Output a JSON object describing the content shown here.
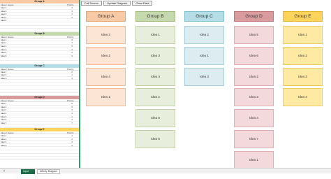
{
  "colors": {
    "a": {
      "header": "#f8c9a5",
      "headerBorder": "#e3a574",
      "card": "#fde5d6",
      "cardBorder": "#f2b994"
    },
    "b": {
      "header": "#c6d8ae",
      "headerBorder": "#9fbb7c",
      "card": "#e7eedc",
      "cardBorder": "#c2d3aa"
    },
    "c": {
      "header": "#b4dde5",
      "headerBorder": "#80c1ce",
      "card": "#dcecf1",
      "cardBorder": "#a9d1db"
    },
    "d": {
      "header": "#d99b9e",
      "headerBorder": "#c07478",
      "card": "#f3d9dc",
      "cardBorder": "#e0aeb2"
    },
    "e": {
      "header": "#ffd45c",
      "headerBorder": "#e3b423",
      "card": "#ffe9a3",
      "cardBorder": "#f1cd5f"
    }
  },
  "toolbar": {
    "full_screen": "Full Screen",
    "update_diagram": "Update Diagram",
    "clear_data": "Clear Data"
  },
  "sheet": {
    "col_idea": "Ideas / Issues",
    "col_priority": "Priority",
    "groups": [
      {
        "title": "Group A",
        "rows": [
          [
            "Idea 1",
            "4"
          ],
          [
            "Idea 2",
            "3"
          ],
          [
            "Idea 3",
            "1"
          ],
          [
            "Idea 4",
            "2"
          ],
          [
            "Idea 5",
            ""
          ],
          [
            "",
            ""
          ],
          [
            "",
            ""
          ],
          [
            "",
            ""
          ]
        ]
      },
      {
        "title": "Group B",
        "rows": [
          [
            "Idea 1",
            "6"
          ],
          [
            "Idea 2",
            "1"
          ],
          [
            "Idea 3",
            "5"
          ],
          [
            "Idea 4",
            "4"
          ],
          [
            "Idea 5",
            "2"
          ],
          [
            "Idea 6",
            "3"
          ],
          [
            "",
            ""
          ],
          [
            "",
            ""
          ]
        ]
      },
      {
        "title": "Group C",
        "rows": [
          [
            "Idea 1",
            "2"
          ],
          [
            "Idea 2",
            "1"
          ],
          [
            "Idea 3",
            "3"
          ],
          [
            "",
            ""
          ],
          [
            "",
            ""
          ],
          [
            "",
            ""
          ],
          [
            "",
            ""
          ],
          [
            "",
            ""
          ]
        ]
      },
      {
        "title": "Group D",
        "rows": [
          [
            "Idea 1",
            "6"
          ],
          [
            "Idea 2",
            "5"
          ],
          [
            "Idea 3",
            "3"
          ],
          [
            "Idea 4",
            "4"
          ],
          [
            "Idea 5",
            "1"
          ],
          [
            "Idea 6",
            "2"
          ],
          [
            "Idea 7",
            "7"
          ],
          [
            "",
            ""
          ]
        ]
      },
      {
        "title": "Group E",
        "rows": [
          [
            "Idea 1",
            "1"
          ],
          [
            "Idea 2",
            "2"
          ],
          [
            "Idea 3",
            "3"
          ],
          [
            "Idea 4",
            "4"
          ],
          [
            "",
            ""
          ],
          [
            "",
            ""
          ],
          [
            "",
            ""
          ],
          [
            "",
            ""
          ]
        ]
      }
    ]
  },
  "board": {
    "columns": [
      {
        "title": "Group A",
        "cards": [
          "Idea 3",
          "Idea 2",
          "Idea 4",
          "Idea 1"
        ]
      },
      {
        "title": "Group B",
        "cards": [
          "Idea 1",
          "Idea 3",
          "Idea 4",
          "Idea 2",
          "Idea 6",
          "Idea 5"
        ]
      },
      {
        "title": "Group C",
        "cards": [
          "Idea 2",
          "Idea 1",
          "Idea 3"
        ]
      },
      {
        "title": "Group D",
        "cards": [
          "Idea 5",
          "Idea 6",
          "Idea 2",
          "Idea 3",
          "Idea 4",
          "Idea 7",
          "Idea 1"
        ]
      },
      {
        "title": "Group E",
        "cards": [
          "Idea 1",
          "Idea 2",
          "Idea 3",
          "Idea 4"
        ]
      }
    ]
  },
  "tabs": {
    "add": "+",
    "active": "Input Data",
    "second": "Affinity Diagram"
  }
}
